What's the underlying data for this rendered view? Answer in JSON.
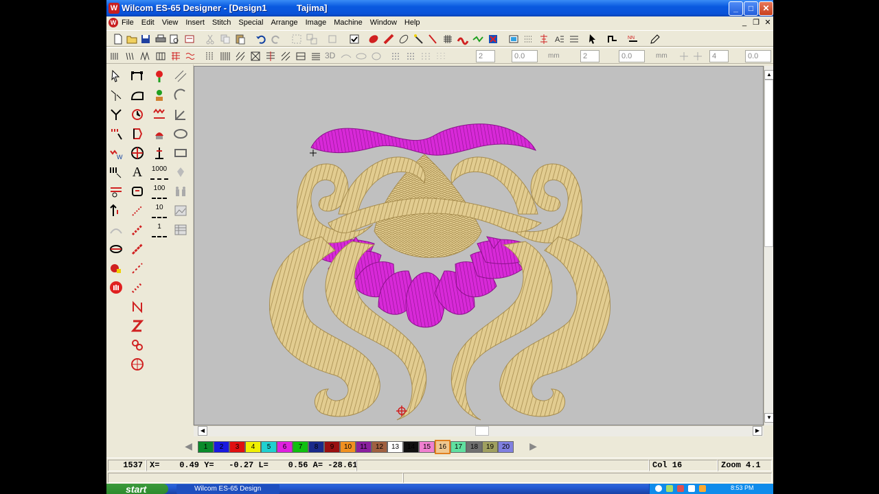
{
  "window": {
    "app_icon_letter": "W",
    "title": "Wilcom ES-65 Designer - [Design1            Tajima]",
    "minimize": "_",
    "maximize": "□",
    "close": "✕"
  },
  "menubar": {
    "doc_icon_letter": "W",
    "items": [
      "File",
      "Edit",
      "View",
      "Insert",
      "Stitch",
      "Special",
      "Arrange",
      "Image",
      "Machine",
      "Window",
      "Help"
    ],
    "mdi_minimize": "_",
    "mdi_restore": "❐",
    "mdi_close": "✕"
  },
  "toolbar2": {
    "label_3d": "3D",
    "spin1": "2",
    "spin2": "0.0",
    "unit1": "mm",
    "spin3": "2",
    "spin4": "0.0",
    "unit2": "mm",
    "spin5": "4",
    "spin6": "0.0"
  },
  "toolbox": {
    "text_tool": "A",
    "count_1000": "1000",
    "count_100": "100",
    "count_10": "10",
    "count_1": "1"
  },
  "palette": {
    "left_arrow": "◀",
    "right_arrow": "▶",
    "selected": "16",
    "swatches": [
      {
        "n": "1",
        "color": "#0a8a2a"
      },
      {
        "n": "2",
        "color": "#1a1ae0"
      },
      {
        "n": "3",
        "color": "#e01010"
      },
      {
        "n": "4",
        "color": "#f0f000"
      },
      {
        "n": "5",
        "color": "#20d0d0"
      },
      {
        "n": "6",
        "color": "#e020e0"
      },
      {
        "n": "7",
        "color": "#10c010"
      },
      {
        "n": "8",
        "color": "#1a2a8a"
      },
      {
        "n": "9",
        "color": "#9a1010"
      },
      {
        "n": "10",
        "color": "#f09020"
      },
      {
        "n": "11",
        "color": "#8a20a0"
      },
      {
        "n": "12",
        "color": "#a06040"
      },
      {
        "n": "13",
        "color": "#ffffff"
      },
      {
        "n": "14",
        "color": "#101010"
      },
      {
        "n": "15",
        "color": "#f080d0"
      },
      {
        "n": "16",
        "color": "#f0c890"
      },
      {
        "n": "17",
        "color": "#60e0a0"
      },
      {
        "n": "18",
        "color": "#707070"
      },
      {
        "n": "19",
        "color": "#a0a060"
      },
      {
        "n": "20",
        "color": "#8080e0"
      }
    ]
  },
  "status": {
    "stitch_count": "1537",
    "coords": "X=    0.49 Y=   -0.27 L=    0.56 A= -28.61",
    "color": "Col 16",
    "zoom": "Zoom 4.1"
  },
  "taskbar": {
    "start": "start",
    "task": "Wilcom ES-65 Design",
    "clock": "8:53 PM"
  },
  "design_colors": {
    "gold": "#e2cc90",
    "gold_shadow": "#a68c4e",
    "magenta": "#d829d8",
    "magenta_shadow": "#8a128a"
  }
}
